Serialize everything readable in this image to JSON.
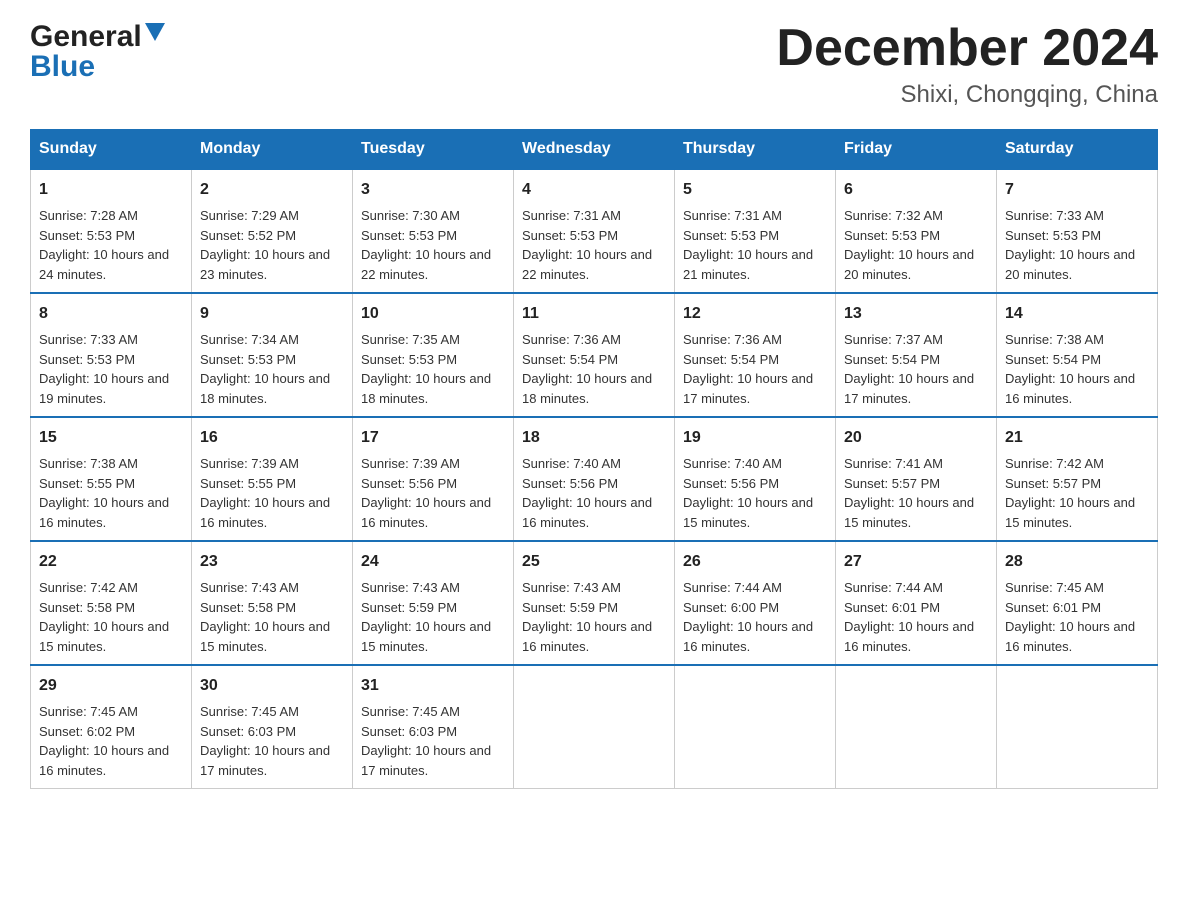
{
  "header": {
    "logo_general": "General",
    "logo_blue": "Blue",
    "title": "December 2024",
    "subtitle": "Shixi, Chongqing, China"
  },
  "columns": [
    "Sunday",
    "Monday",
    "Tuesday",
    "Wednesday",
    "Thursday",
    "Friday",
    "Saturday"
  ],
  "weeks": [
    [
      {
        "day": "1",
        "sunrise": "7:28 AM",
        "sunset": "5:53 PM",
        "daylight": "10 hours and 24 minutes."
      },
      {
        "day": "2",
        "sunrise": "7:29 AM",
        "sunset": "5:52 PM",
        "daylight": "10 hours and 23 minutes."
      },
      {
        "day": "3",
        "sunrise": "7:30 AM",
        "sunset": "5:53 PM",
        "daylight": "10 hours and 22 minutes."
      },
      {
        "day": "4",
        "sunrise": "7:31 AM",
        "sunset": "5:53 PM",
        "daylight": "10 hours and 22 minutes."
      },
      {
        "day": "5",
        "sunrise": "7:31 AM",
        "sunset": "5:53 PM",
        "daylight": "10 hours and 21 minutes."
      },
      {
        "day": "6",
        "sunrise": "7:32 AM",
        "sunset": "5:53 PM",
        "daylight": "10 hours and 20 minutes."
      },
      {
        "day": "7",
        "sunrise": "7:33 AM",
        "sunset": "5:53 PM",
        "daylight": "10 hours and 20 minutes."
      }
    ],
    [
      {
        "day": "8",
        "sunrise": "7:33 AM",
        "sunset": "5:53 PM",
        "daylight": "10 hours and 19 minutes."
      },
      {
        "day": "9",
        "sunrise": "7:34 AM",
        "sunset": "5:53 PM",
        "daylight": "10 hours and 18 minutes."
      },
      {
        "day": "10",
        "sunrise": "7:35 AM",
        "sunset": "5:53 PM",
        "daylight": "10 hours and 18 minutes."
      },
      {
        "day": "11",
        "sunrise": "7:36 AM",
        "sunset": "5:54 PM",
        "daylight": "10 hours and 18 minutes."
      },
      {
        "day": "12",
        "sunrise": "7:36 AM",
        "sunset": "5:54 PM",
        "daylight": "10 hours and 17 minutes."
      },
      {
        "day": "13",
        "sunrise": "7:37 AM",
        "sunset": "5:54 PM",
        "daylight": "10 hours and 17 minutes."
      },
      {
        "day": "14",
        "sunrise": "7:38 AM",
        "sunset": "5:54 PM",
        "daylight": "10 hours and 16 minutes."
      }
    ],
    [
      {
        "day": "15",
        "sunrise": "7:38 AM",
        "sunset": "5:55 PM",
        "daylight": "10 hours and 16 minutes."
      },
      {
        "day": "16",
        "sunrise": "7:39 AM",
        "sunset": "5:55 PM",
        "daylight": "10 hours and 16 minutes."
      },
      {
        "day": "17",
        "sunrise": "7:39 AM",
        "sunset": "5:56 PM",
        "daylight": "10 hours and 16 minutes."
      },
      {
        "day": "18",
        "sunrise": "7:40 AM",
        "sunset": "5:56 PM",
        "daylight": "10 hours and 16 minutes."
      },
      {
        "day": "19",
        "sunrise": "7:40 AM",
        "sunset": "5:56 PM",
        "daylight": "10 hours and 15 minutes."
      },
      {
        "day": "20",
        "sunrise": "7:41 AM",
        "sunset": "5:57 PM",
        "daylight": "10 hours and 15 minutes."
      },
      {
        "day": "21",
        "sunrise": "7:42 AM",
        "sunset": "5:57 PM",
        "daylight": "10 hours and 15 minutes."
      }
    ],
    [
      {
        "day": "22",
        "sunrise": "7:42 AM",
        "sunset": "5:58 PM",
        "daylight": "10 hours and 15 minutes."
      },
      {
        "day": "23",
        "sunrise": "7:43 AM",
        "sunset": "5:58 PM",
        "daylight": "10 hours and 15 minutes."
      },
      {
        "day": "24",
        "sunrise": "7:43 AM",
        "sunset": "5:59 PM",
        "daylight": "10 hours and 15 minutes."
      },
      {
        "day": "25",
        "sunrise": "7:43 AM",
        "sunset": "5:59 PM",
        "daylight": "10 hours and 16 minutes."
      },
      {
        "day": "26",
        "sunrise": "7:44 AM",
        "sunset": "6:00 PM",
        "daylight": "10 hours and 16 minutes."
      },
      {
        "day": "27",
        "sunrise": "7:44 AM",
        "sunset": "6:01 PM",
        "daylight": "10 hours and 16 minutes."
      },
      {
        "day": "28",
        "sunrise": "7:45 AM",
        "sunset": "6:01 PM",
        "daylight": "10 hours and 16 minutes."
      }
    ],
    [
      {
        "day": "29",
        "sunrise": "7:45 AM",
        "sunset": "6:02 PM",
        "daylight": "10 hours and 16 minutes."
      },
      {
        "day": "30",
        "sunrise": "7:45 AM",
        "sunset": "6:03 PM",
        "daylight": "10 hours and 17 minutes."
      },
      {
        "day": "31",
        "sunrise": "7:45 AM",
        "sunset": "6:03 PM",
        "daylight": "10 hours and 17 minutes."
      },
      null,
      null,
      null,
      null
    ]
  ]
}
